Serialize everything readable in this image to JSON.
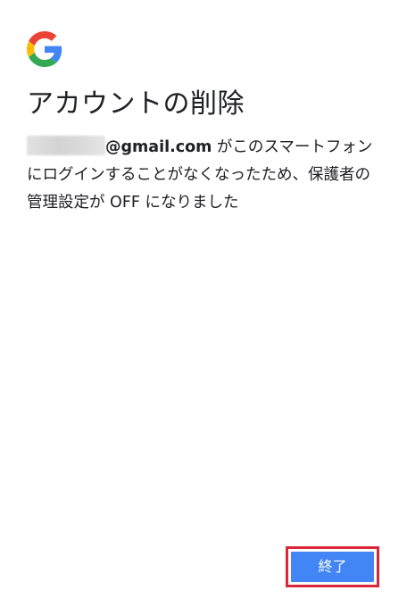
{
  "colors": {
    "primary_button": "#4285f4",
    "highlight_border": "#d9263a",
    "text": "#202124",
    "google_blue": "#4285F4",
    "google_red": "#EA4335",
    "google_yellow": "#FBBC05",
    "google_green": "#34A853"
  },
  "icons": {
    "logo": "google-g-logo"
  },
  "dialog": {
    "title": "アカウントの削除",
    "email_domain": "@gmail.com",
    "message_after_email": " がこのスマートフォンにログインすることがなくなったため、保護者の管理設定が OFF になりました"
  },
  "actions": {
    "finish_label": "終了"
  }
}
